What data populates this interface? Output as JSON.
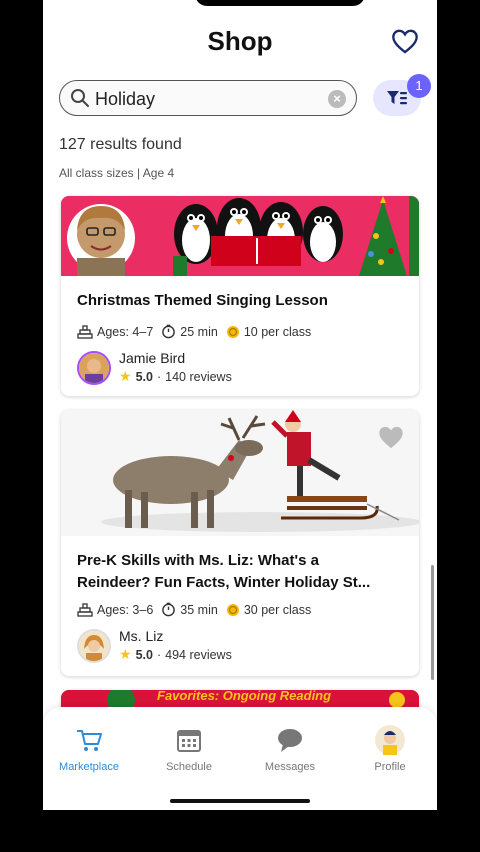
{
  "header": {
    "title": "Shop"
  },
  "search": {
    "value": "Holiday"
  },
  "filter": {
    "badge_count": "1"
  },
  "results": {
    "count_text": "127 results found",
    "summary": "All class sizes | Age 4"
  },
  "cards": [
    {
      "title": "Christmas Themed  Singing Lesson",
      "ages": "Ages: 4–7",
      "duration": "25 min",
      "price": "10 per class",
      "teacher": "Jamie Bird",
      "rating": "5.0",
      "reviews": "140 reviews"
    },
    {
      "title_line1": "Pre-K Skills with Ms. Liz: What's a",
      "title_line2": "Reindeer? Fun Facts, Winter Holiday St...",
      "ages": "Ages: 3–6",
      "duration": "35 min",
      "price": "30 per class",
      "teacher": "Ms. Liz",
      "rating": "5.0",
      "reviews": "494 reviews"
    },
    {
      "banner_text": "Favorites: Ongoing Reading"
    }
  ],
  "tabs": [
    {
      "label": "Marketplace",
      "icon": "cart-icon"
    },
    {
      "label": "Schedule",
      "icon": "calendar-icon"
    },
    {
      "label": "Messages",
      "icon": "chat-icon"
    },
    {
      "label": "Profile",
      "icon": "avatar"
    }
  ],
  "colors": {
    "accent": "#2e8bd4",
    "badge": "#6c63ff",
    "filter_bg": "#e6e6ff"
  }
}
